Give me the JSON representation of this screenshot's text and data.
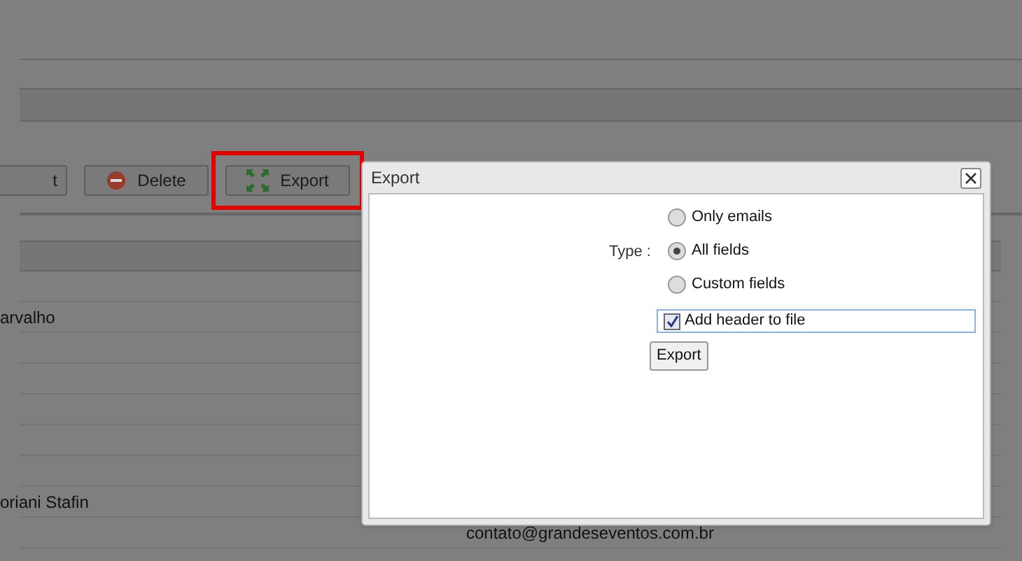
{
  "toolbar": [
    {
      "label": "t",
      "kind": "plain"
    },
    {
      "label": "Delete",
      "kind": "delete",
      "highlighted": false
    },
    {
      "label": "Export",
      "kind": "export",
      "highlighted": true
    }
  ],
  "rows": [
    {},
    {
      "column_1": "arvalho"
    },
    {},
    {},
    {},
    {},
    {},
    {
      "column_1": "oriani Stafin"
    },
    {
      "column_2": "contato@grandeseventos.com.br"
    }
  ],
  "dialog": {
    "title": "Export",
    "type_label": "Type :",
    "options": [
      {
        "label": "Only emails",
        "selected": false
      },
      {
        "label": "All fields",
        "selected": true
      },
      {
        "label": "Custom fields",
        "selected": false
      }
    ],
    "header_checkbox": {
      "label": "Add header to file",
      "checked": true
    },
    "button": "Export"
  }
}
